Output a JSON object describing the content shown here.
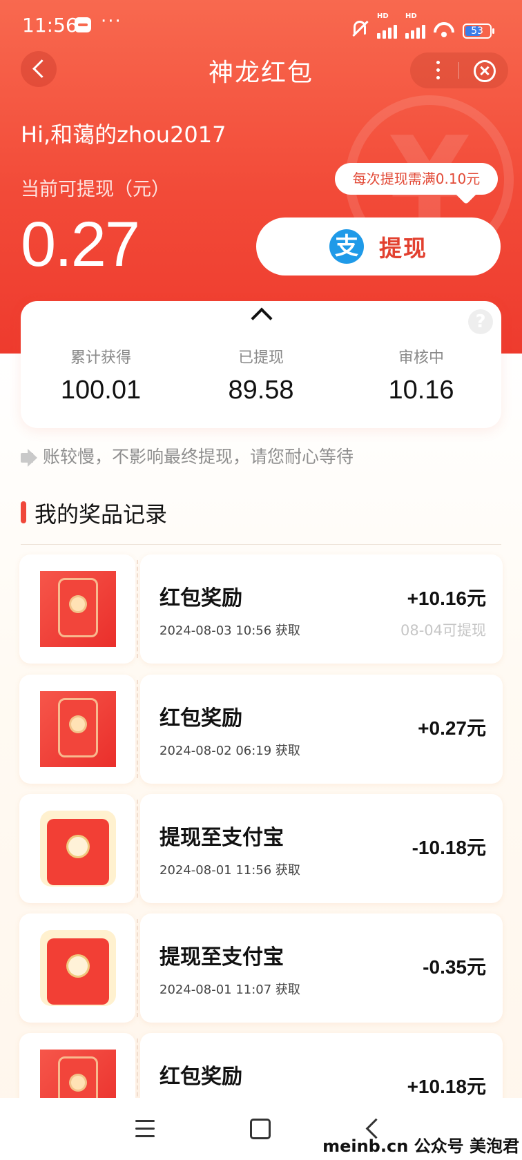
{
  "status_bar": {
    "time": "11:56",
    "dots": "···",
    "hd1": "HD",
    "hd2": "HD",
    "battery": "53"
  },
  "nav": {
    "title": "神龙红包"
  },
  "header": {
    "greeting": "Hi,和蔼的zhou2017",
    "withdrawable_label": "当前可提现（元）",
    "amount": "0.27",
    "tip": "每次提现需满0.10元",
    "withdraw_button": "提现",
    "alipay_glyph": "支"
  },
  "stats": [
    {
      "label": "累计获得",
      "value": "100.01"
    },
    {
      "label": "已提现",
      "value": "89.58"
    },
    {
      "label": "审核中",
      "value": "10.16"
    }
  ],
  "help_glyph": "?",
  "notice": "账较慢，不影响最终提现，请您耐心等待",
  "section_title": "我的奖品记录",
  "records": [
    {
      "title": "红包奖励",
      "time": "2024-08-03 10:56 获取",
      "amount": "+10.16元",
      "note": "08-04可提现"
    },
    {
      "title": "红包奖励",
      "time": "2024-08-02 06:19 获取",
      "amount": "+0.27元",
      "note": ""
    },
    {
      "title": "提现至支付宝",
      "time": "2024-08-01 11:56 获取",
      "amount": "-10.18元",
      "note": ""
    },
    {
      "title": "提现至支付宝",
      "time": "2024-08-01 11:07 获取",
      "amount": "-0.35元",
      "note": ""
    },
    {
      "title": "红包奖励",
      "time": "",
      "amount": "+10.18元",
      "note": ""
    }
  ],
  "watermark": "meinb.cn  公众号 美泡君",
  "colors": {
    "brand_red": "#f24a38",
    "withdraw_text": "#e2402f",
    "alipay_blue": "#1f9ae8"
  }
}
